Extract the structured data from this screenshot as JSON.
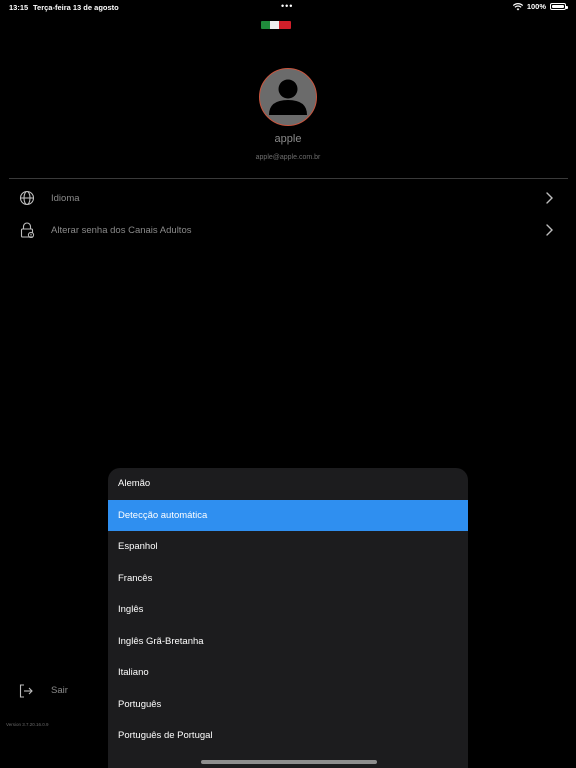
{
  "status_bar": {
    "time": "13:15",
    "date": "Terça-feira 13 de agosto",
    "dots": "•••",
    "battery": "100%"
  },
  "profile": {
    "name": "apple",
    "email": "apple@apple.com.br"
  },
  "menu": [
    {
      "label": "Idioma",
      "icon": "globe-icon"
    },
    {
      "label": "Alterar senha dos Canais Adultos",
      "icon": "lock-icon"
    }
  ],
  "logout": {
    "label": "Sair",
    "icon": "logout-icon"
  },
  "version": "Version 3.7.20.16.0.9",
  "language_sheet": {
    "options": [
      "Alemão",
      "Detecção automática",
      "Espanhol",
      "Francês",
      "Inglês",
      "Inglês Grã-Bretanha",
      "Italiano",
      "Português",
      "Português de Portugal"
    ],
    "selected_index": 1
  },
  "colors": {
    "background": "#000000",
    "sheet": "#1c1c1e",
    "selected": "#2f8ff0",
    "avatar_border": "#c9553e",
    "muted_text": "#8a8a8a"
  }
}
